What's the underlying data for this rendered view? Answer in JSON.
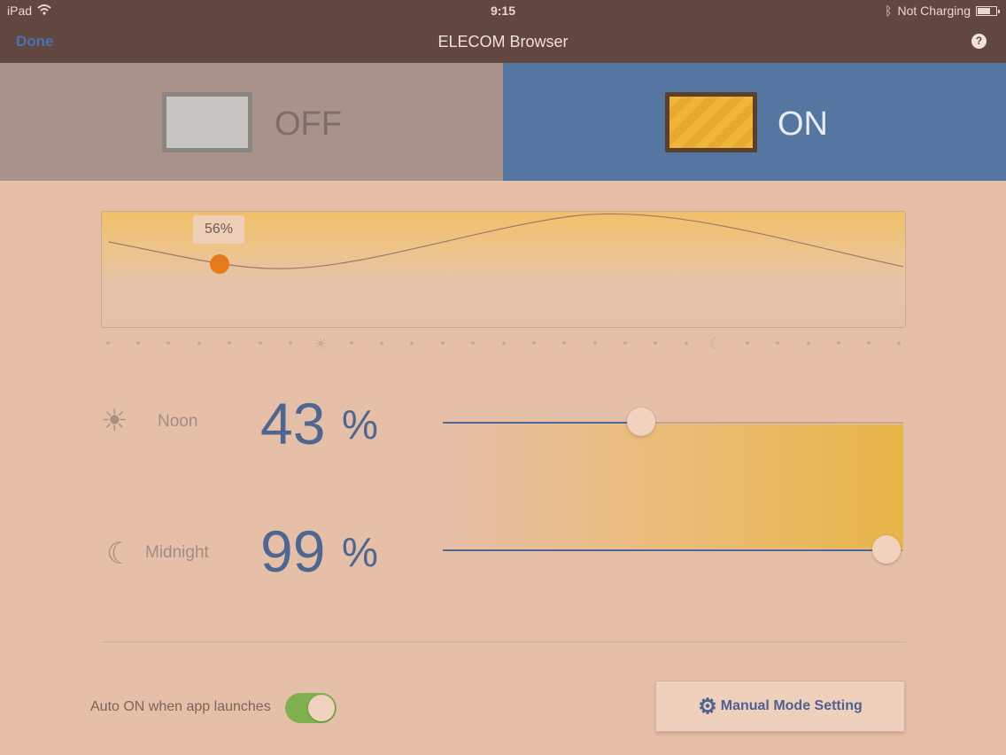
{
  "status_bar": {
    "device": "iPad",
    "time": "9:15",
    "charging": "Not Charging"
  },
  "nav": {
    "done": "Done",
    "title": "ELECOM Browser",
    "help": "?"
  },
  "toggle": {
    "off_label": "OFF",
    "on_label": "ON",
    "selected": "ON"
  },
  "graph": {
    "tooltip": "56%",
    "current_value_percent": 56
  },
  "rows": {
    "noon": {
      "label": "Noon",
      "value": "43",
      "unit": "%",
      "icon": "sun-icon",
      "slider_fraction": 0.43
    },
    "midnight": {
      "label": "Midnight",
      "value": "99",
      "unit": "%",
      "icon": "moon-icon",
      "slider_fraction": 0.99
    }
  },
  "footer": {
    "auto_on_label": "Auto ON when app launches",
    "auto_on_enabled": true,
    "manual_button": "Manual Mode Setting"
  },
  "colors": {
    "accent": "#4f6790",
    "on_segment": "#5576a0",
    "switch_on": "#7fb04f",
    "marker": "#e87a1e"
  }
}
